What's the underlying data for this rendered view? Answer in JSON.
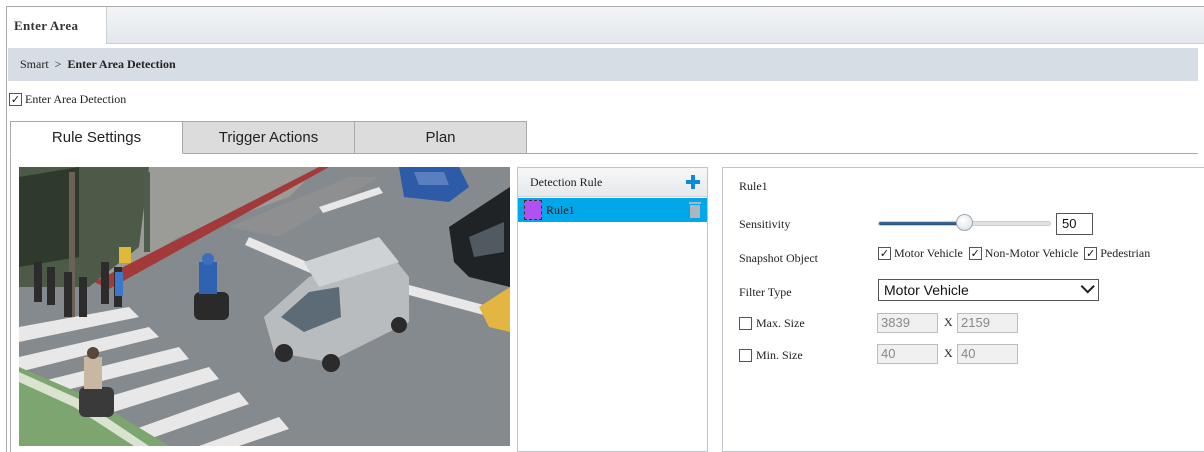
{
  "top_tab": {
    "label": "Enter Area"
  },
  "breadcrumb": {
    "root": "Smart",
    "separator": ">",
    "current": "Enter Area Detection"
  },
  "enable": {
    "label": "Enter Area Detection",
    "checked": true
  },
  "subtabs": [
    {
      "label": "Rule Settings",
      "active": true
    },
    {
      "label": "Trigger Actions",
      "active": false
    },
    {
      "label": "Plan",
      "active": false
    }
  ],
  "rule_list": {
    "header": "Detection Rule",
    "add_icon": "plus-icon",
    "rules": [
      {
        "name": "Rule1",
        "color": "#b152f0",
        "selected": true
      }
    ],
    "delete_icon": "trash-icon"
  },
  "settings": {
    "title": "Rule1",
    "sensitivity": {
      "label": "Sensitivity",
      "value": "50",
      "fraction": 0.5
    },
    "snapshot": {
      "label": "Snapshot Object",
      "options": [
        {
          "label": "Motor Vehicle",
          "checked": true
        },
        {
          "label": "Non-Motor Vehicle",
          "checked": true
        },
        {
          "label": "Pedestrian",
          "checked": true
        }
      ]
    },
    "filter_type": {
      "label": "Filter Type",
      "value": "Motor Vehicle"
    },
    "max_size": {
      "label": "Max. Size",
      "checked": false,
      "width": "3839",
      "height": "2159",
      "sep": "X"
    },
    "min_size": {
      "label": "Min. Size",
      "checked": false,
      "width": "40",
      "height": "40",
      "sep": "X"
    }
  },
  "colors": {
    "accent": "#00a8ea",
    "rule_color": "#b152f0",
    "add_icon": "#0b8bd9"
  }
}
